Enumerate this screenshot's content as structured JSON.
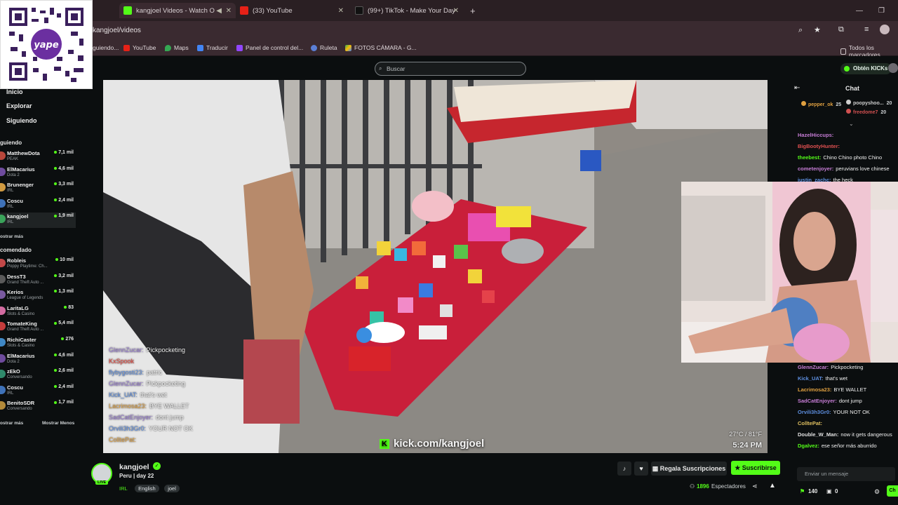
{
  "browser": {
    "tabs": [
      {
        "title": "kangjoel Videos - Watch O",
        "active": true
      },
      {
        "title": "(33) YouTube",
        "active": false
      },
      {
        "title": "(99+) TikTok - Make Your Day",
        "active": false
      }
    ],
    "url": "kangjoel/videos",
    "bookmarks": [
      "guiendo...",
      "YouTube",
      "Maps",
      "Traducir",
      "Panel de control del...",
      "Ruleta",
      "FOTOS CÁMARA - G...",
      "Todos los marcadores"
    ]
  },
  "header": {
    "search_placeholder": "Buscar",
    "get_kicks": "Obtén KICKs"
  },
  "sidebar": {
    "nav": [
      "Inicio",
      "Explorar",
      "Siguiendo"
    ],
    "following_title": "guiendo",
    "following": [
      {
        "name": "MatthewDota",
        "category": "PEAK",
        "viewers": "7,1 mil",
        "color": "#b7473b"
      },
      {
        "name": "ElMacarius",
        "category": "Dota 2",
        "viewers": "4,6 mil",
        "color": "#6e4b9d"
      },
      {
        "name": "Brunenger",
        "category": "IRL",
        "viewers": "3,3 mil",
        "color": "#d09a41"
      },
      {
        "name": "Coscu",
        "category": "IRL",
        "viewers": "2,4 mil",
        "color": "#3f72b8"
      },
      {
        "name": "kangjoel",
        "category": "IRL",
        "viewers": "1,9 mil",
        "color": "#3aa35a"
      }
    ],
    "show_more_1": "ostrar más",
    "recommended_title": "comendado",
    "recommended": [
      {
        "name": "Robleis",
        "category": "Poppy Playtime: Ch...",
        "viewers": "10 mil",
        "color": "#c24848"
      },
      {
        "name": "DessT3",
        "category": "Grand Theft Auto ...",
        "viewers": "3,2 mil",
        "color": "#5a5a5a"
      },
      {
        "name": "Kerios",
        "category": "League of Legends",
        "viewers": "1,3 mil",
        "color": "#7a5aa0"
      },
      {
        "name": "LaritaLG",
        "category": "Slots & Casino",
        "viewers": "83",
        "color": "#d36ca1"
      },
      {
        "name": "TomateKing",
        "category": "Grand Theft Auto ...",
        "viewers": "5,4 mil",
        "color": "#c43c3c"
      },
      {
        "name": "RichiCaster",
        "category": "Slots & Casino",
        "viewers": "276",
        "color": "#3f88c5"
      },
      {
        "name": "ElMacarius",
        "category": "Dota 2",
        "viewers": "4,6 mil",
        "color": "#6e4b9d"
      },
      {
        "name": "zEkO",
        "category": "Conversando",
        "viewers": "2,6 mil",
        "color": "#2f8a6b"
      },
      {
        "name": "Coscu",
        "category": "IRL",
        "viewers": "2,4 mil",
        "color": "#3f72b8"
      },
      {
        "name": "BenitoSDR",
        "category": "Conversando",
        "viewers": "1,7 mil",
        "color": "#b38a3a"
      }
    ],
    "show_more_2": "ostrar más",
    "show_less": "Mostrar Menos"
  },
  "video": {
    "overlay_chat": [
      {
        "user": "GlennZucar:",
        "msg": "Pickpocketing",
        "color": "#9b7fd6"
      },
      {
        "user": "KxSpook",
        "msg": "",
        "color": "#e8483f"
      },
      {
        "user": "flybygosti23:",
        "msg": "patric",
        "color": "#5e8fe0"
      },
      {
        "user": "GlennZucar:",
        "msg": "Pickpocketing",
        "color": "#9b7fd6"
      },
      {
        "user": "Kick_UAT:",
        "msg": "that's wet",
        "color": "#5e8fe0"
      },
      {
        "user": "Lacrimosa23:",
        "msg": "BYE WALLET",
        "color": "#e0a040"
      },
      {
        "user": "SadCatEnjoyer:",
        "msg": "dont jump",
        "color": "#9b7fd6"
      },
      {
        "user": "Orvili3h3Gr0:",
        "msg": "YOUR NOT OK",
        "color": "#5e8fe0"
      },
      {
        "user": "ColltePat:",
        "msg": "",
        "color": "#e0a040"
      }
    ],
    "kick_url": "kick.com/kangjoel",
    "temperature": "27°C / 81°F",
    "time": "5:24 PM"
  },
  "chat": {
    "title": "Chat",
    "pinned": [
      {
        "user": "pepper_ok",
        "sub": "25",
        "color": "#e0a040"
      },
      {
        "user": "poopyshoo...",
        "sub": "20",
        "color": "#cfcfcf"
      },
      {
        "user": "freedome7",
        "sub": "20",
        "color": "#d05050"
      }
    ],
    "messages_top": [
      {
        "user": "HazelHiccups:",
        "msg": "",
        "color": "#c77dd6"
      },
      {
        "user": "BigBootyHunter:",
        "msg": "",
        "color": "#e05050"
      },
      {
        "user": "theebest:",
        "msg": "Chino Chino photo Chino",
        "color": "#53fc18"
      },
      {
        "user": "cometenjoyer:",
        "msg": "peruvians love chinese",
        "color": "#c77dd6"
      },
      {
        "user": "justin_zachc:",
        "msg": "the heck",
        "color": "#5e8fe0"
      }
    ],
    "messages_bottom": [
      {
        "user": "GlennZucar:",
        "msg": "Pickpocketing",
        "color": "#c77dd6"
      },
      {
        "user": "Kick_UAT:",
        "msg": "that's wet",
        "color": "#5e8fe0"
      },
      {
        "user": "Lacrimosa23:",
        "msg": "BYE WALLET",
        "color": "#e0a040"
      },
      {
        "user": "SadCatEnjoyer:",
        "msg": "dont jump",
        "color": "#c77dd6"
      },
      {
        "user": "Orvili3h3Gr0:",
        "msg": "YOUR NOT OK",
        "color": "#5e8fe0"
      },
      {
        "user": "ColltePat:",
        "msg": "",
        "color": "#e0c060"
      },
      {
        "user": "Double_W_Man:",
        "msg": "now it gets dangerous",
        "color": "#e0e0e0"
      },
      {
        "user": "Dgalvez:",
        "msg": "ese señor más aburrido",
        "color": "#53fc18"
      }
    ],
    "input_placeholder": "Enviar un mensaje",
    "kicks_count": "140",
    "other_count": "0",
    "send_label": "Ch"
  },
  "stream": {
    "name": "kangjoel",
    "live_badge": "LIVE",
    "title": "Peru | day 22",
    "tags": [
      "IRL",
      "English",
      "joel"
    ],
    "gift_label": "Regala Suscripciones",
    "subscribe_label": "Suscribirse",
    "viewers_count": "1896",
    "viewers_label": "Espectadores"
  },
  "colors": {
    "kick_green": "#53fc18",
    "background": "#0b0e0f"
  }
}
